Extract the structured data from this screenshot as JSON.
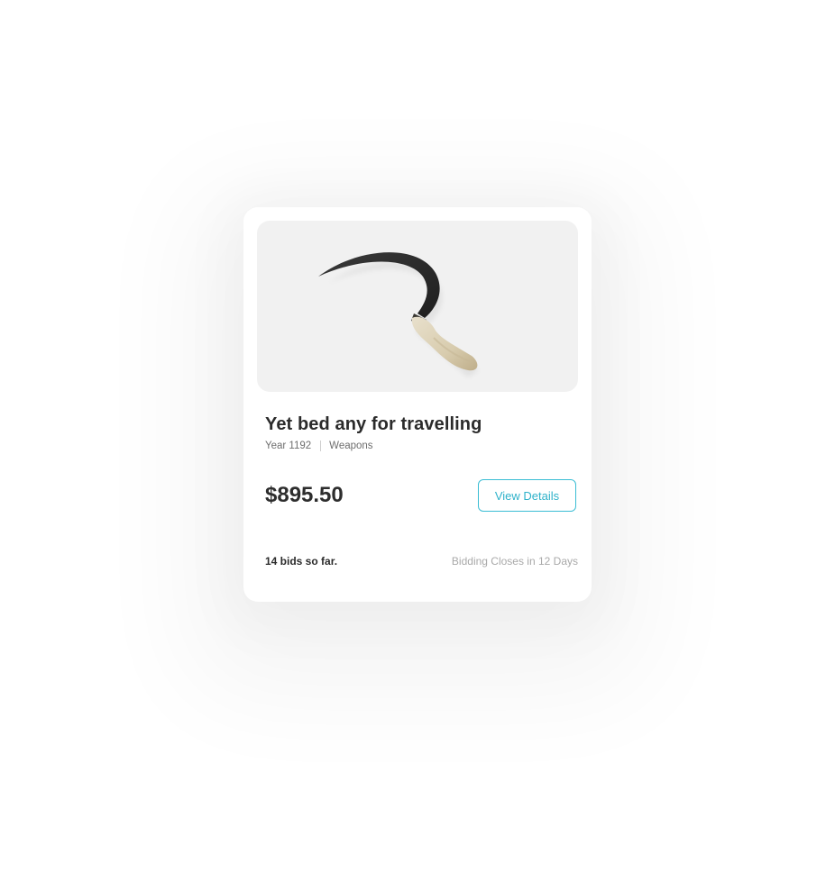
{
  "item": {
    "image_alt": "Sickle",
    "title": "Yet bed any for travelling",
    "year": "Year 1192",
    "category": "Weapons",
    "price": "$895.50",
    "details_label": "View Details",
    "bids": "14 bids so far.",
    "closes": "Bidding Closes in 12 Days"
  },
  "colors": {
    "accent": "#3bbdd4",
    "title": "#2b2b2b",
    "muted": "#a9a9a9",
    "image_bg": "#f1f1f1"
  }
}
